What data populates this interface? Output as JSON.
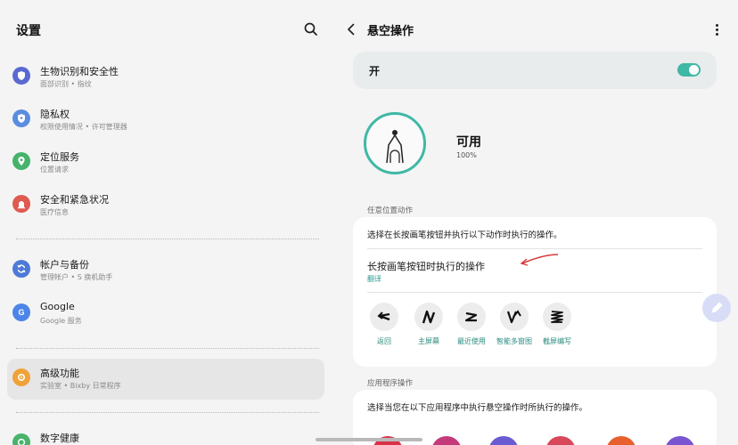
{
  "left": {
    "title": "设置",
    "items": [
      {
        "title": "生物识别和安全性",
        "subtitle": "面部识别 • 指纹",
        "icon": "shield-icon",
        "color": "#5b6ad0"
      },
      {
        "title": "隐私权",
        "subtitle": "权限使用情况 • 许可管理器",
        "icon": "privacy-icon",
        "color": "#5a8de0"
      },
      {
        "title": "定位服务",
        "subtitle": "位置请求",
        "icon": "location-pin-icon",
        "color": "#45b36b"
      },
      {
        "title": "安全和紧急状况",
        "subtitle": "医疗信息",
        "icon": "emergency-icon",
        "color": "#e05a4f"
      },
      {
        "title": "帐户与备份",
        "subtitle": "管理帐户 • S 换机助手",
        "icon": "sync-icon",
        "color": "#4d7ad6"
      },
      {
        "title": "Google",
        "subtitle": "Google 服务",
        "icon": "google-icon",
        "color": "#4d86e8"
      },
      {
        "title": "高级功能",
        "subtitle": "实验室 • Bixby 日常程序",
        "icon": "gear-plus-icon",
        "color": "#f0a23a"
      },
      {
        "title": "数字健康",
        "subtitle": "",
        "icon": "wellbeing-icon",
        "color": "#48b36a"
      }
    ]
  },
  "right": {
    "title": "悬空操作",
    "toggle_label": "开",
    "toggle_on": true,
    "accent": "#3fb8a5",
    "status_title": "可用",
    "status_percent": "100%",
    "section1_label": "任意位置动作",
    "card1_desc": "选择在长按画笔按钮并执行以下动作时执行的操作。",
    "card1_action": "长按画笔按钮时执行的操作",
    "card1_translate": "翻译",
    "gestures": [
      {
        "label": "返回",
        "icon": "gesture-back-icon"
      },
      {
        "label": "主屏幕",
        "icon": "gesture-home-icon"
      },
      {
        "label": "最近使用",
        "icon": "gesture-recent-icon"
      },
      {
        "label": "智能多窗图",
        "icon": "gesture-multiwindow-icon"
      },
      {
        "label": "截屏编写",
        "icon": "gesture-screenwrite-icon"
      }
    ],
    "section2_label": "应用程序操作",
    "card2_desc": "选择当您在以下应用程序中执行悬空操作时所执行的操作。",
    "app_colors": [
      "#d9334a",
      "#c43a7a",
      "#6b5bd3",
      "#d9475a",
      "#e8602e",
      "#7a55d1"
    ]
  }
}
